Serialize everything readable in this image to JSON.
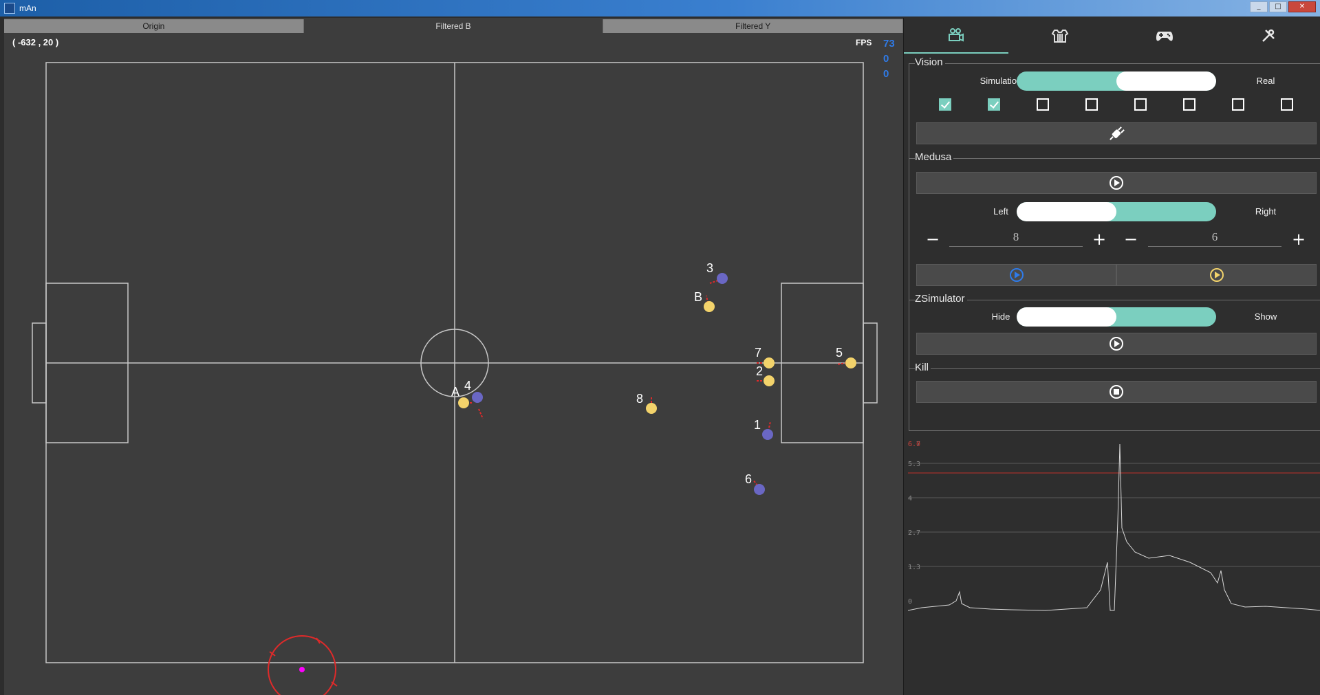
{
  "window": {
    "title": "mAn",
    "icon": "app-icon",
    "controls": [
      "minimize-icon",
      "maximize-icon",
      "close-icon"
    ]
  },
  "field": {
    "tabs": [
      {
        "label": "Origin"
      },
      {
        "label": "Filtered B"
      },
      {
        "label": "Filtered Y"
      }
    ],
    "coordinate_readout": "( -632 , 20 )",
    "fps": {
      "label": "FPS",
      "values": [
        "73",
        "0",
        "0"
      ]
    },
    "robots": [
      {
        "label": "3",
        "team": "blue"
      },
      {
        "label": "B",
        "team": "yellow"
      },
      {
        "label": "7",
        "team": "yellow"
      },
      {
        "label": "2",
        "team": "yellow"
      },
      {
        "label": "5",
        "team": "yellow"
      },
      {
        "label": "A",
        "team": "yellow"
      },
      {
        "label": "4",
        "team": "blue"
      },
      {
        "label": "8",
        "team": "yellow"
      },
      {
        "label": "1",
        "team": "blue"
      },
      {
        "label": "6",
        "team": "blue"
      }
    ],
    "colors": {
      "blue_team": "#6a67c4",
      "yellow_team": "#f3d36b",
      "field_bg": "#3d3d3d",
      "lines": "#c8c8c8",
      "marker_ring": "#e02a2a",
      "marker_dot": "#ff00ff"
    }
  },
  "panel": {
    "tabs": [
      {
        "name": "camera-icon",
        "active": true
      },
      {
        "name": "jersey-icon",
        "active": false
      },
      {
        "name": "gamepad-icon",
        "active": false
      },
      {
        "name": "tools-icon",
        "active": false
      }
    ],
    "vision": {
      "title": "Vision",
      "toggle_left": "Simulation",
      "toggle_right": "Real",
      "toggle_state": "right",
      "checkboxes": [
        true,
        true,
        false,
        false,
        false,
        false,
        false,
        false
      ],
      "connect_button_icon": "plug-icon"
    },
    "medusa": {
      "title": "Medusa",
      "play_icon": "play-icon",
      "toggle_left": "Left",
      "toggle_right": "Right",
      "toggle_state": "left",
      "stepper_left_value": "8",
      "stepper_right_value": "6",
      "blue_play_icon": "play-icon-blue",
      "yellow_play_icon": "play-icon-yellow"
    },
    "zsimulator": {
      "title": "ZSimulator",
      "toggle_left": "Hide",
      "toggle_right": "Show",
      "toggle_state": "left",
      "play_icon": "play-icon"
    },
    "kill": {
      "title": "Kill",
      "stop_icon": "stop-icon"
    },
    "graph": {
      "y_ticks": [
        "0",
        "1.3",
        "2.7",
        "4",
        "5.3",
        "6.7"
      ],
      "threshold_label": "6.0",
      "threshold_color": "#c0302a"
    }
  },
  "accent": "#7bcfbf"
}
